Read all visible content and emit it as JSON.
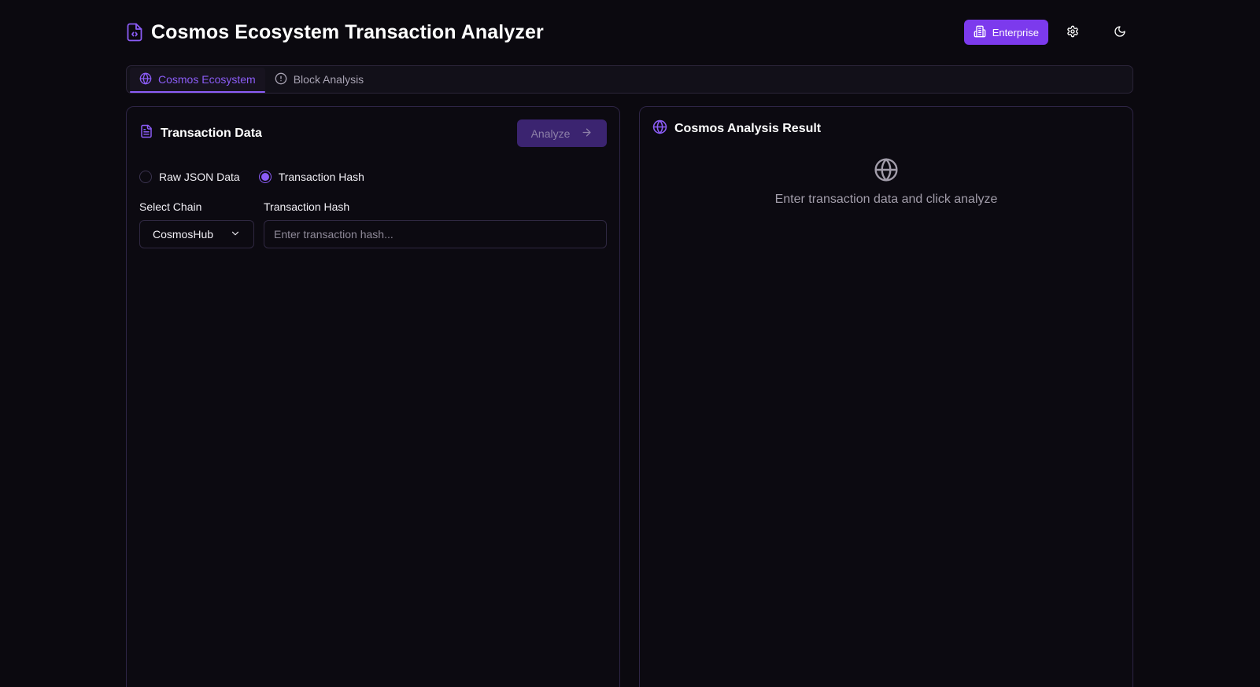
{
  "header": {
    "title": "Cosmos Ecosystem Transaction Analyzer",
    "logo_icon": "file-code-icon",
    "enterprise_label": "Enterprise",
    "enterprise_icon": "building-icon",
    "settings_icon": "gear-icon",
    "theme_icon": "moon-icon"
  },
  "tabs": [
    {
      "label": "Cosmos Ecosystem",
      "icon": "globe-icon",
      "active": true
    },
    {
      "label": "Block Analysis",
      "icon": "alert-circle-icon",
      "active": false
    }
  ],
  "input_panel": {
    "title": "Transaction Data",
    "title_icon": "file-text-icon",
    "analyze_label": "Analyze",
    "analyze_icon": "arrow-right-icon",
    "radio_options": [
      {
        "label": "Raw JSON Data",
        "checked": false
      },
      {
        "label": "Transaction Hash",
        "checked": true
      }
    ],
    "chain_label": "Select Chain",
    "chain_value": "CosmosHub",
    "hash_label": "Transaction Hash",
    "hash_placeholder": "Enter transaction hash...",
    "hash_value": ""
  },
  "result_panel": {
    "title": "Cosmos Analysis Result",
    "title_icon": "globe-icon",
    "empty_message": "Enter transaction data and click analyze"
  },
  "colors": {
    "background": "#0b090f",
    "accent": "#8b5cf6",
    "button_primary": "#7c3aed",
    "button_disabled": "#3b2470",
    "border": "#2e2546",
    "muted_text": "#a29daa"
  }
}
